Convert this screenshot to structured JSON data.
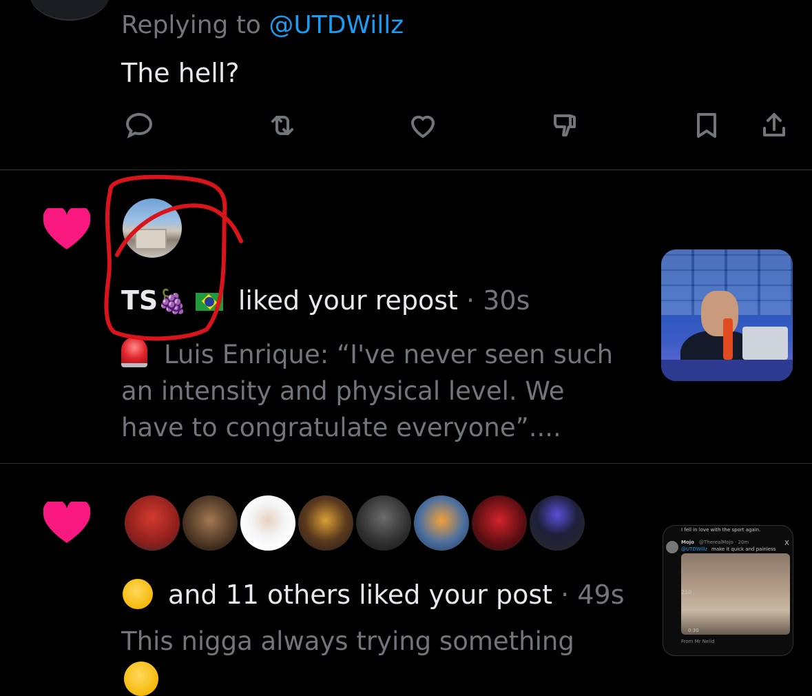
{
  "reply": {
    "prefix": "Replying to ",
    "handle": "@UTDWillz",
    "text": "The hell?"
  },
  "actions": [
    {
      "icon": "reply-icon"
    },
    {
      "icon": "repost-icon"
    },
    {
      "icon": "like-icon"
    },
    {
      "icon": "dislike-icon"
    },
    {
      "icon": "bookmark-icon"
    },
    {
      "icon": "share-icon"
    }
  ],
  "notification1": {
    "icon": "heart-icon",
    "color": "#f91880",
    "name": "TS",
    "action": "liked your repost",
    "separator": "·",
    "time": "30s",
    "snippet": "Luis Enrique: “I've never seen such an intensity and physical level. We have to congratulate everyone”...."
  },
  "notification2": {
    "icon": "heart-icon",
    "color": "#f91880",
    "action": "and 11 others liked your post",
    "separator": "·",
    "time": "49s",
    "snippet": "This nigga always trying something",
    "thumb": {
      "header": "I fell in love with the sport again.",
      "name": "Mojo",
      "handle": "@TherealMojo · 20m",
      "mention": "@UTDWillz",
      "text": "make it quick and painless",
      "time_code": "0:30",
      "badge": "210",
      "from": "From Mr Nelid",
      "close": "X"
    }
  },
  "colors": {
    "background": "#000000",
    "text": "#e7e9ea",
    "muted": "#71767b",
    "link": "#1d9bf0",
    "heart": "#f91880",
    "annotation": "#d9141a"
  }
}
